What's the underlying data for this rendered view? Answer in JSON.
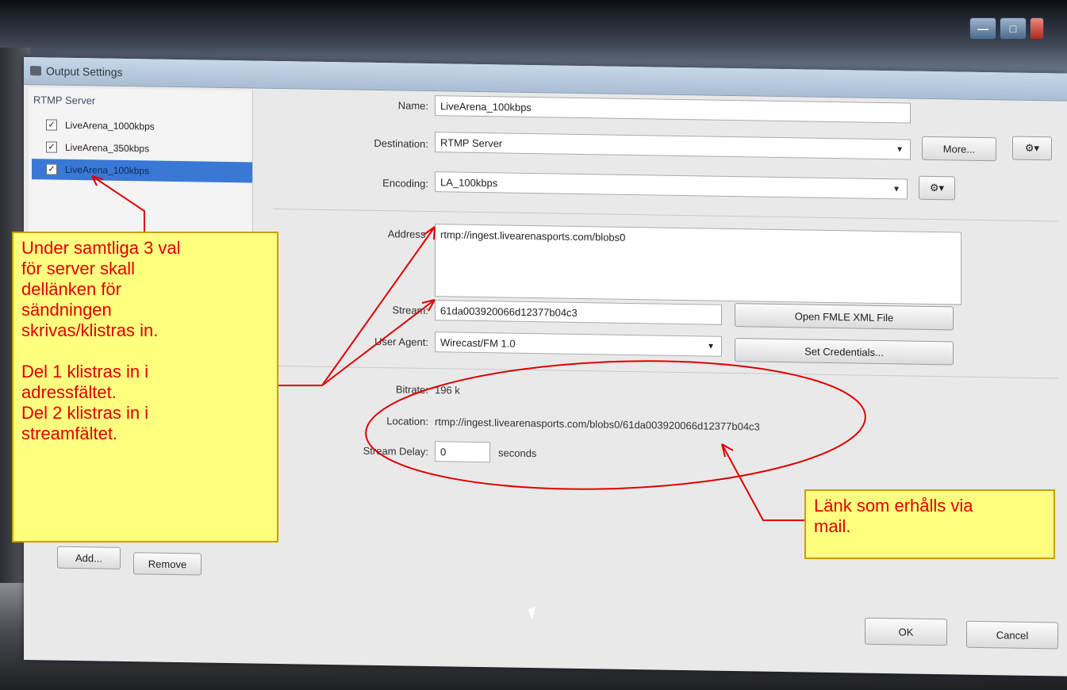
{
  "window": {
    "title": "Output Settings",
    "controls": {
      "minimize": "—",
      "maximize": "□",
      "close": "✕"
    }
  },
  "sidebar": {
    "group_label": "RTMP Server",
    "items": [
      {
        "label": "LiveArena_1000kbps",
        "checked": true
      },
      {
        "label": "LiveArena_350kbps",
        "checked": true
      },
      {
        "label": "LiveArena_100kbps",
        "checked": true,
        "selected": true
      }
    ],
    "check_glyph": "✓",
    "add_label": "Add...",
    "remove_label": "Remove"
  },
  "form": {
    "name_label": "Name:",
    "name_value": "LiveArena_100kbps",
    "destination_label": "Destination:",
    "destination_value": "RTMP Server",
    "more_label": "More...",
    "encoding_label": "Encoding:",
    "encoding_value": "LA_100kbps",
    "gear_glyph": "⚙▾",
    "address_label": "Address:",
    "address_value": "rtmp://ingest.livearenasports.com/blobs0",
    "stream_label": "Stream:",
    "stream_value": "61da003920066d12377b04c3",
    "open_fmle_label": "Open FMLE XML File",
    "user_agent_label": "User Agent:",
    "user_agent_value": "Wirecast/FM 1.0",
    "set_credentials_label": "Set Credentials...",
    "bitrate_label": "Bitrate:",
    "bitrate_value": "196 k",
    "location_label": "Location:",
    "location_value": "rtmp://ingest.livearenasports.com/blobs0/61da003920066d12377b04c3",
    "stream_delay_label": "Stream Delay:",
    "stream_delay_value": "0",
    "seconds_label": "seconds",
    "dropdown_arrow": "▼"
  },
  "footer": {
    "ok_label": "OK",
    "cancel_label": "Cancel"
  },
  "annotations": {
    "note_left": [
      "Under samtliga 3 val",
      "för server skall",
      "dellänken för",
      "sändningen",
      "skrivas/klistras in.",
      "",
      "Del 1 klistras in i",
      "adressfältet.",
      "Del 2 klistras in i",
      "streamfältet."
    ],
    "note_right": [
      "Länk som erhålls via",
      "mail."
    ],
    "annotation_color": "#e00000",
    "note_background": "#ffff80"
  }
}
